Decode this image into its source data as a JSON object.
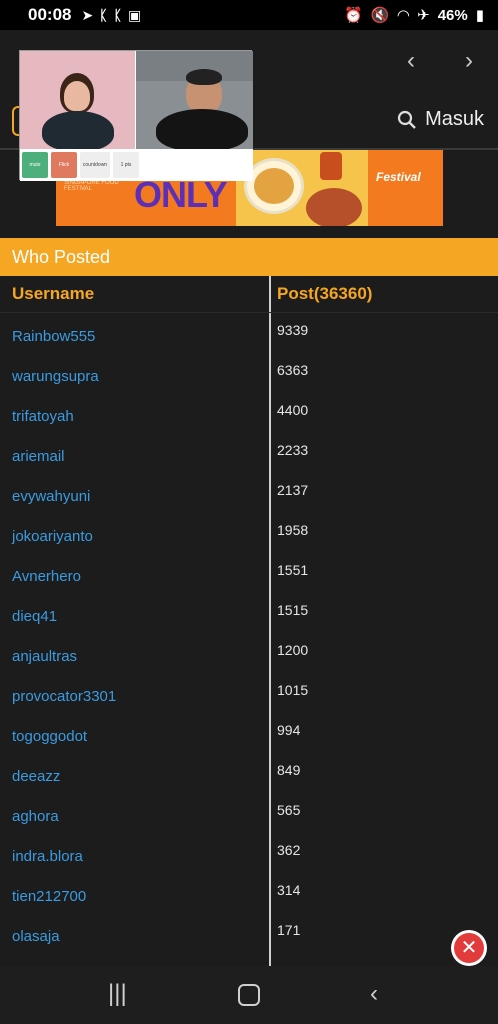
{
  "status": {
    "time": "00:08",
    "battery": "46%",
    "notif_icons": [
      "telegram-icon",
      "k-icon",
      "k-icon",
      "image-icon"
    ],
    "right_icons": [
      "alarm-icon",
      "mute-icon",
      "wifi-icon",
      "airplane-icon"
    ]
  },
  "header": {
    "prev": "‹",
    "next": "›",
    "login_label": "Masuk"
  },
  "banner": {
    "headline": "ONLY",
    "subtext": "SINGAPORE FOOD FESTIVAL",
    "festival": "Festival"
  },
  "pip": {
    "btn_labels": [
      "mute",
      "Flick",
      "countdown",
      "1 pts"
    ]
  },
  "section": {
    "title": "Who Posted"
  },
  "table": {
    "col_username": "Username",
    "col_post": "Post(36360)",
    "rows": [
      {
        "user": "Rainbow555",
        "posts": "9339"
      },
      {
        "user": "warungsupra",
        "posts": "6363"
      },
      {
        "user": "trifatoyah",
        "posts": "4400"
      },
      {
        "user": "ariemail",
        "posts": "2233"
      },
      {
        "user": "evywahyuni",
        "posts": "2137"
      },
      {
        "user": "jokoariyanto",
        "posts": "1958"
      },
      {
        "user": "Avnerhero",
        "posts": "1551"
      },
      {
        "user": "dieq41",
        "posts": "1515"
      },
      {
        "user": "anjaultras",
        "posts": "1200"
      },
      {
        "user": "provocator3301",
        "posts": "1015"
      },
      {
        "user": "togoggodot",
        "posts": "994"
      },
      {
        "user": "deeazz",
        "posts": "849"
      },
      {
        "user": "aghora",
        "posts": "565"
      },
      {
        "user": "indra.blora",
        "posts": "362"
      },
      {
        "user": "tien212700",
        "posts": "314"
      },
      {
        "user": "olasaja",
        "posts": "171"
      }
    ]
  },
  "colors": {
    "accent": "#f5a623",
    "link": "#3a9be0",
    "background": "#1c1c1c"
  }
}
